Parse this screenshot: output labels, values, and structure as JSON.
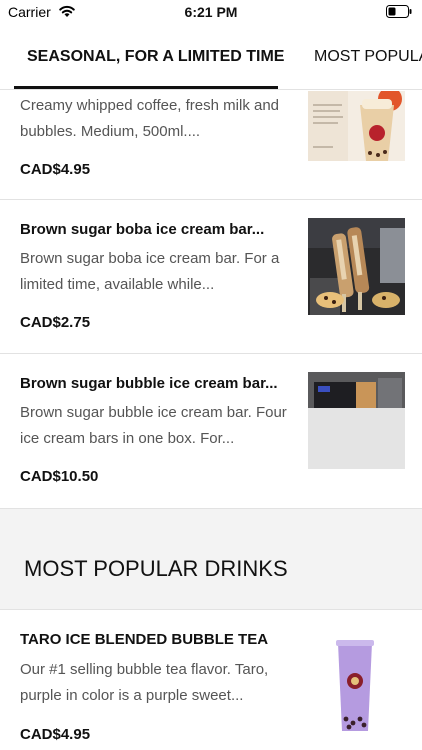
{
  "status_bar": {
    "carrier": "Carrier",
    "time": "6:21 PM"
  },
  "tabs": [
    {
      "label": "SEASONAL, FOR A LIMITED TIME",
      "active": true
    },
    {
      "label": "MOST POPULAR DRINKS",
      "active": false
    }
  ],
  "items": [
    {
      "title": "",
      "desc": "Creamy whipped coffee, fresh milk and bubbles. Medium, 500ml....",
      "price": "CAD$4.95",
      "image": "whipped-coffee-photo"
    },
    {
      "title": "Brown sugar boba ice cream bar...",
      "desc": "Brown sugar boba ice cream bar. For a limited time, available while...",
      "price": "CAD$2.75",
      "image": "ice-cream-bar-photo"
    },
    {
      "title": "Brown sugar bubble ice cream bar...",
      "desc": "Brown sugar bubble ice cream bar. Four ice cream bars in one box. For...",
      "price": "CAD$10.50",
      "image": "ice-cream-box-photo"
    }
  ],
  "section": {
    "title": "MOST POPULAR DRINKS"
  },
  "popular_items": [
    {
      "title": "TARO ICE BLENDED BUBBLE TEA",
      "desc": "Our #1 selling bubble tea flavor. Taro, purple in color is a purple sweet...",
      "price": "CAD$4.95",
      "image": "taro-bubble-tea-photo"
    }
  ],
  "colors": {
    "text": "#111111",
    "muted": "#555555",
    "divider": "#e2e2e2",
    "section_bg": "#f3f3f3",
    "taro": "#b59be0"
  }
}
